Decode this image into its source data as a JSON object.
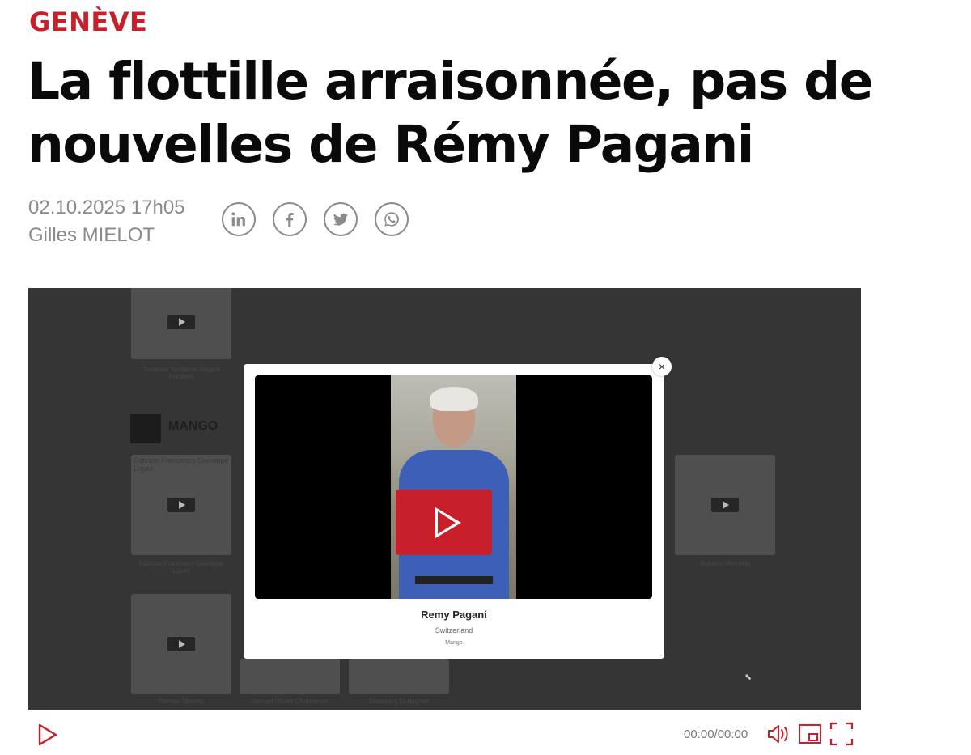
{
  "article": {
    "kicker": "GENÈVE",
    "title": "La flottille arraisonnée, pas de nouvelles de Rémy Pagani",
    "date": "02.10.2025 17h05",
    "author": "Gilles MIELOT"
  },
  "share": {
    "icons": [
      "linkedin-icon",
      "facebook-icon",
      "twitter-icon",
      "whatsapp-icon"
    ]
  },
  "video": {
    "background": {
      "brand_label": "MANGO",
      "thumb_captions": [
        "Tummasi Tavillanei Nagara Nikolaini",
        "Fabrizio Francesco Giuseppe Lopez",
        "Roberto Vennella",
        "Romain Mbamo",
        "Samuel Olivier Chatelanne",
        "Sebastien Dubugnon"
      ],
      "thumb_title": "Fabrizio Francesco Giuseppe Lopez"
    },
    "modal": {
      "close_label": "×",
      "name": "Remy Pagani",
      "country": "Switzerland",
      "brand": "Mango"
    },
    "controls": {
      "time": "00:00/00:00"
    },
    "accent_color": "#c8202b"
  }
}
